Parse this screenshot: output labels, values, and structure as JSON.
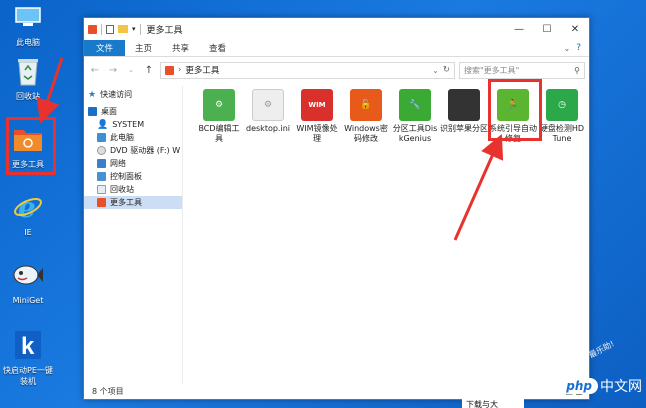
{
  "desktop": {
    "icons": [
      {
        "label": "此电脑"
      },
      {
        "label": "回收站"
      },
      {
        "label": "更多工具"
      },
      {
        "label": "IE"
      },
      {
        "label": "MiniGet"
      },
      {
        "label": "快启动PE一键装机"
      }
    ],
    "watermark": {
      "logo": "php",
      "text": "中文网"
    },
    "diag_text": "最乐助!",
    "bottom_text": "下载与大"
  },
  "window": {
    "title": "更多工具",
    "controls": {
      "minimize": "—",
      "maximize": "☐",
      "close": "✕"
    },
    "ribbon": {
      "tabs": [
        "文件",
        "主页",
        "共享",
        "查看"
      ],
      "help": "?"
    },
    "address": {
      "path": "更多工具"
    },
    "search": {
      "placeholder": "搜索\"更多工具\""
    },
    "nav": [
      {
        "label": "快速访问"
      },
      {
        "label": "桌面"
      },
      {
        "label": "SYSTEM"
      },
      {
        "label": "此电脑"
      },
      {
        "label": "DVD 驱动器 (F:) W"
      },
      {
        "label": "网络"
      },
      {
        "label": "控制面板"
      },
      {
        "label": "回收站"
      },
      {
        "label": "更多工具"
      }
    ],
    "files": [
      {
        "label": "BCD编辑工具",
        "icon": "gear-icon",
        "color": "#4caf50"
      },
      {
        "label": "desktop.ini",
        "icon": "settings-file-icon",
        "color": "#dcdcdc"
      },
      {
        "label": "WIM镜像处理",
        "icon": "wim-icon",
        "color": "#d9302c"
      },
      {
        "label": "Windows密码修改",
        "icon": "lock-icon",
        "color": "#e85a1a"
      },
      {
        "label": "分区工具DiskGenius",
        "icon": "wrench-icon",
        "color": "#3aaa35"
      },
      {
        "label": "识别苹果分区",
        "icon": "apple-icon",
        "color": "#333333"
      },
      {
        "label": "系统引导自动修复",
        "icon": "runner-icon",
        "color": "#5cb531"
      },
      {
        "label": "硬盘检测HDTune",
        "icon": "clock-icon",
        "color": "#2aa84a"
      }
    ],
    "status": {
      "count": "8 个项目"
    },
    "highlight_color": "#e8322e"
  }
}
